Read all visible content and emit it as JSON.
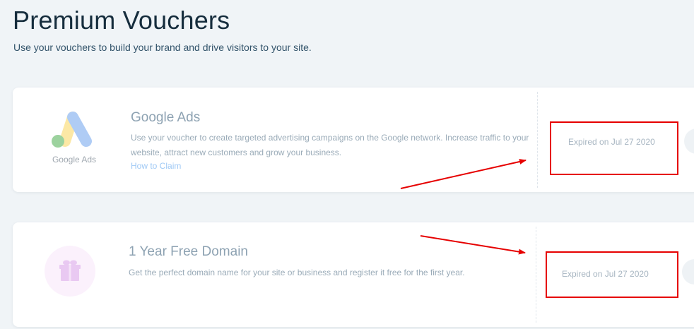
{
  "header": {
    "title": "Premium Vouchers",
    "subtitle": "Use your vouchers to build your brand and drive visitors to your site."
  },
  "vouchers": [
    {
      "title": "Google Ads",
      "logo_text": "Google Ads",
      "description": "Use your voucher to create targeted advertising campaigns on the Google network. Increase traffic to your website, attract new customers and grow your business.",
      "link": "How to Claim",
      "status": "Expired on Jul 27 2020",
      "icon": "google-ads-logo"
    },
    {
      "title": "1 Year Free Domain",
      "description": "Get the perfect domain name for your site or business and register it free for the first year.",
      "status": "Expired on Jul 27 2020",
      "icon": "gift-icon"
    }
  ],
  "colors": {
    "background": "#f0f4f7",
    "title": "#162d3d",
    "annotation": "#e60000",
    "link": "#9fc9f5"
  }
}
